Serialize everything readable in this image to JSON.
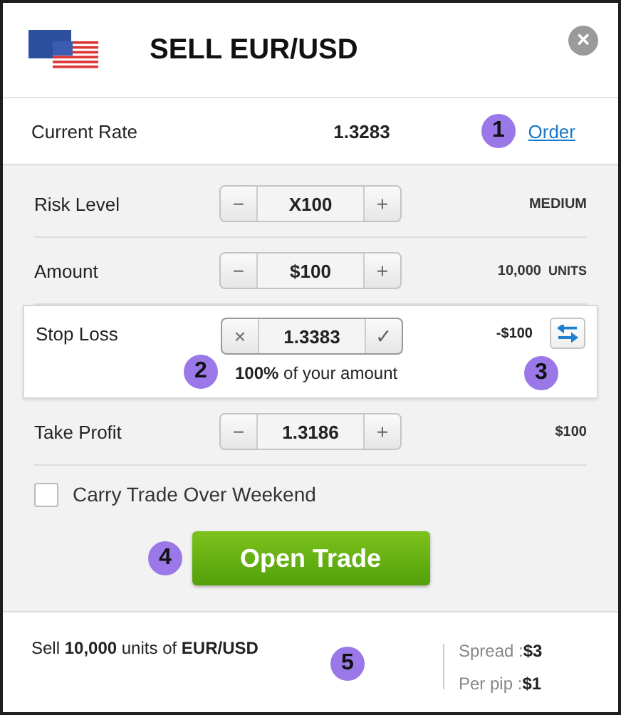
{
  "header": {
    "title": "SELL EUR/USD",
    "close": "×"
  },
  "current_rate": {
    "label": "Current Rate",
    "value": "1.3283",
    "link": "Order",
    "callout": "1"
  },
  "controls": [
    {
      "kind": "stepper",
      "label": "Risk Level",
      "minus": "−",
      "value": "X100",
      "plus": "+",
      "side": "MEDIUM"
    },
    {
      "kind": "stepper",
      "label": "Amount",
      "minus": "−",
      "value": "$100",
      "plus": "+",
      "side": "10,000",
      "side_unit": "UNITS"
    },
    {
      "kind": "stoploss",
      "label": "Stop Loss",
      "minus": "×",
      "value": "1.3383",
      "plus": "✓",
      "side": "-$100",
      "note": "**100%** of your amount",
      "note_callout": "2",
      "swap_callout": "3"
    },
    {
      "kind": "stepper",
      "label": "Take Profit",
      "minus": "−",
      "value": "1.3186",
      "plus": "+",
      "side": "$100"
    }
  ],
  "carry": {
    "label": "Carry Trade Over Weekend",
    "checked": false
  },
  "open_button": {
    "label": "Open Trade",
    "callout": "4"
  },
  "footer": {
    "summary": "Sell **10,000** units of **EUR/USD**",
    "callout": "5",
    "stats": [
      {
        "label": "Spread :",
        "value": "$3"
      },
      {
        "label": "Per pip :",
        "value": "$1"
      }
    ]
  }
}
